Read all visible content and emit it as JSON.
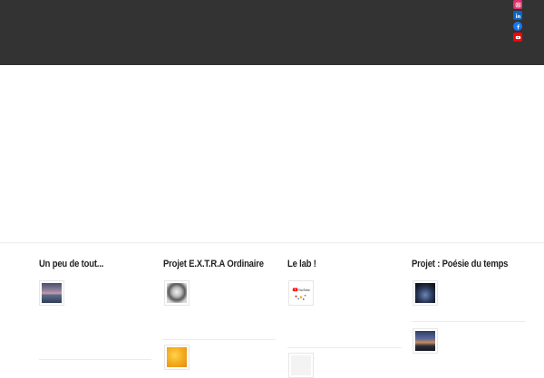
{
  "header": {
    "social": [
      {
        "name": "instagram",
        "color": "#e1306c"
      },
      {
        "name": "linkedin",
        "color": "#0a66c2"
      },
      {
        "name": "facebook",
        "color": "#1877f2"
      },
      {
        "name": "youtube",
        "color": "#ff0000"
      }
    ]
  },
  "footer": {
    "columns": [
      {
        "title": "Un peu de tout..."
      },
      {
        "title": "Projet E.X.T.R.A Ordinaire"
      },
      {
        "title": "Le lab !"
      },
      {
        "title": "Projet : Poésie du temps"
      }
    ],
    "youtube_logo_text": "YouTube"
  }
}
